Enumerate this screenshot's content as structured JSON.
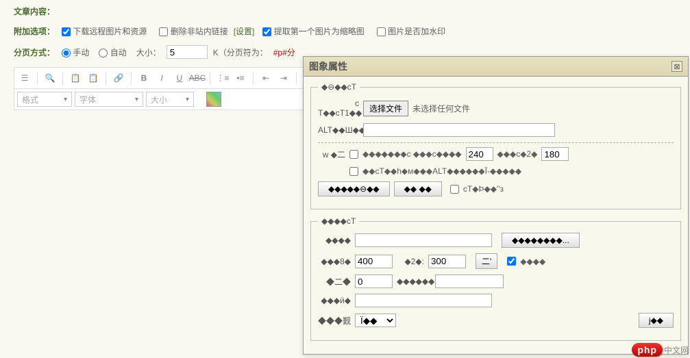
{
  "section": {
    "content_label": "文章内容："
  },
  "options": {
    "label": "附加选项：",
    "download_remote": "下载远程图片和资源",
    "remove_links": "删除非站内链接",
    "settings": "[设置]",
    "extract_first": "提取第一个图片为缩略图",
    "watermark": "图片是否加水印"
  },
  "paging": {
    "label": "分页方式：",
    "manual": "手动",
    "auto": "自动",
    "size_label": "大小：",
    "size_value": "5",
    "k_label": "K（分页符为：",
    "separator": "#p#分",
    "end": "）"
  },
  "toolbar": {
    "format": "格式",
    "font": "字体",
    "size": "大小"
  },
  "dialog": {
    "title": "图象属性",
    "fieldset1_legend": "◆⊖◆◆cT",
    "file_label": "c T◆◆cT1◆◆",
    "choose_file": "选择文件",
    "no_file": "未选择任何文件",
    "alt_label": "ALT◆◆Ш◆◆",
    "w_label": "w ◆二",
    "chk_label1": "◆◆◆◆◆◆◆c ◆◆◆c◆◆◆◆",
    "width_val": "240",
    "between": "◆◆◆c◆2◆",
    "height_val": "180",
    "chk_label2": "◆◆cT◆◆h◆м◆◆◆ALT◆◆◆◆◆◆Ï-◆◆◆◆◆",
    "btn1": "◆◆◆◆◆⊖◆◆",
    "btn2": "◆◆ ◆◆",
    "chk3": "cT◆Þ◆◆''з",
    "fieldset2_legend": "◆◆◆◆cT",
    "f2_label1": "◆◆◆◆",
    "browse": "◆◆◆◆◆◆◆◆...",
    "f2_label2": "◆◆◆8◆",
    "f2_val1": "400",
    "f2_label3": "◆2◆:",
    "f2_val2": "300",
    "reset": "二'",
    "f2_chk": "◆◆◆◆",
    "f2_label4": "◆二◆",
    "f2_val3": "0",
    "f2_label5": "◆◆◆◆◆◆:",
    "f2_label6": "◆◆◆ӥ◆",
    "f2_label7": "◆◆◆觐",
    "f2_select": "Ï◆◆",
    "f2_btn_j": "j◆◆"
  },
  "watermark_logo": {
    "php": "php",
    "cn": "中文网"
  }
}
